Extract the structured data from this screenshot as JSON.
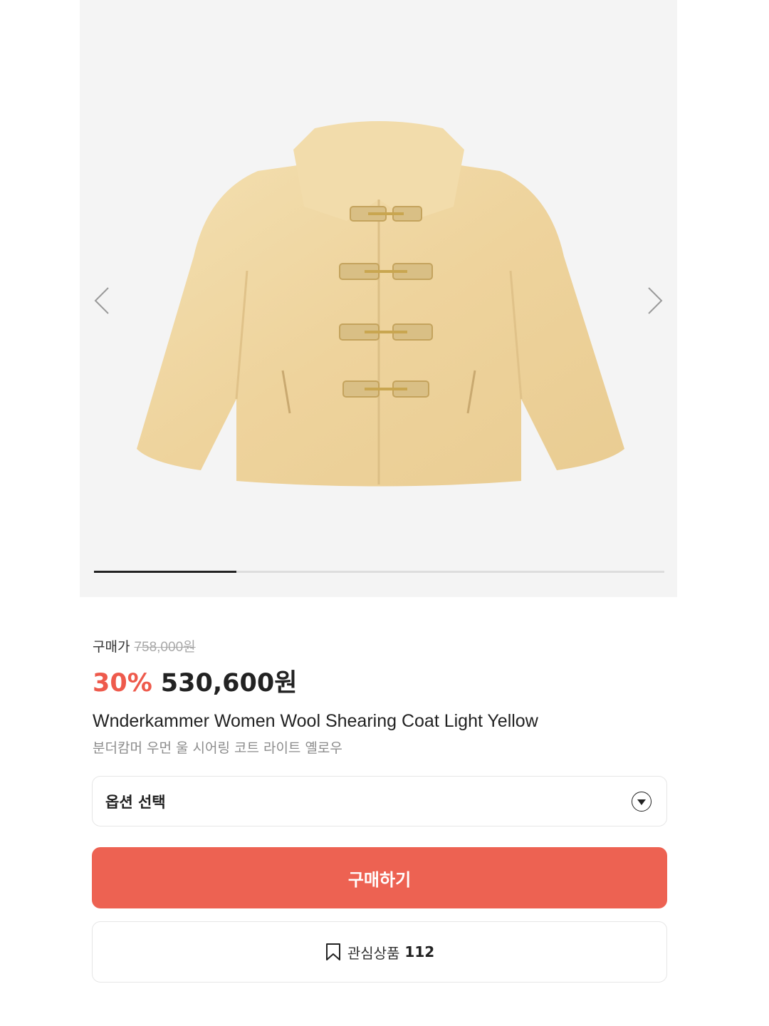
{
  "gallery": {
    "image_alt": "Wnderkammer Women Wool Shearing Coat Light Yellow",
    "progress_fraction": 0.25,
    "prev_icon": "chevron-left-icon",
    "next_icon": "chevron-right-icon"
  },
  "price": {
    "label": "구매가",
    "original": "758,000원",
    "discount": "30%",
    "sale": "530,600원"
  },
  "product": {
    "title_en": "Wnderkammer Women Wool Shearing Coat Light Yellow",
    "title_ko": "분더캄머 우먼 울 시어링 코트 라이트 옐로우"
  },
  "option": {
    "label": "옵션 선택",
    "icon": "dropdown-arrow-icon"
  },
  "actions": {
    "buy_label": "구매하기",
    "wish_label": "관심상품",
    "wish_count": "112",
    "wish_icon": "bookmark-icon"
  },
  "colors": {
    "accent": "#ed6252",
    "discount": "#ee5a4c",
    "gallery_bg": "#f4f4f4"
  }
}
